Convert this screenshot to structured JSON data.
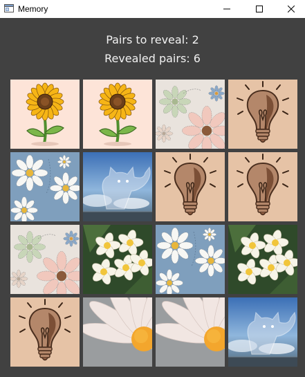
{
  "window": {
    "title": "Memory"
  },
  "status": {
    "pairs_to_reveal": "Pairs to reveal: 2",
    "revealed_pairs": "Revealed pairs: 6"
  },
  "board": {
    "rows": 4,
    "cols": 4,
    "cards": [
      "sunflower",
      "sunflower",
      "pastel-flowers",
      "lightbulb",
      "blue-daisies",
      "cat-sky",
      "lightbulb",
      "lightbulb",
      "pastel-flowers",
      "frangipani",
      "blue-daisies",
      "frangipani",
      "lightbulb",
      "daisy-closeup",
      "daisy-closeup",
      "cat-sky"
    ]
  }
}
